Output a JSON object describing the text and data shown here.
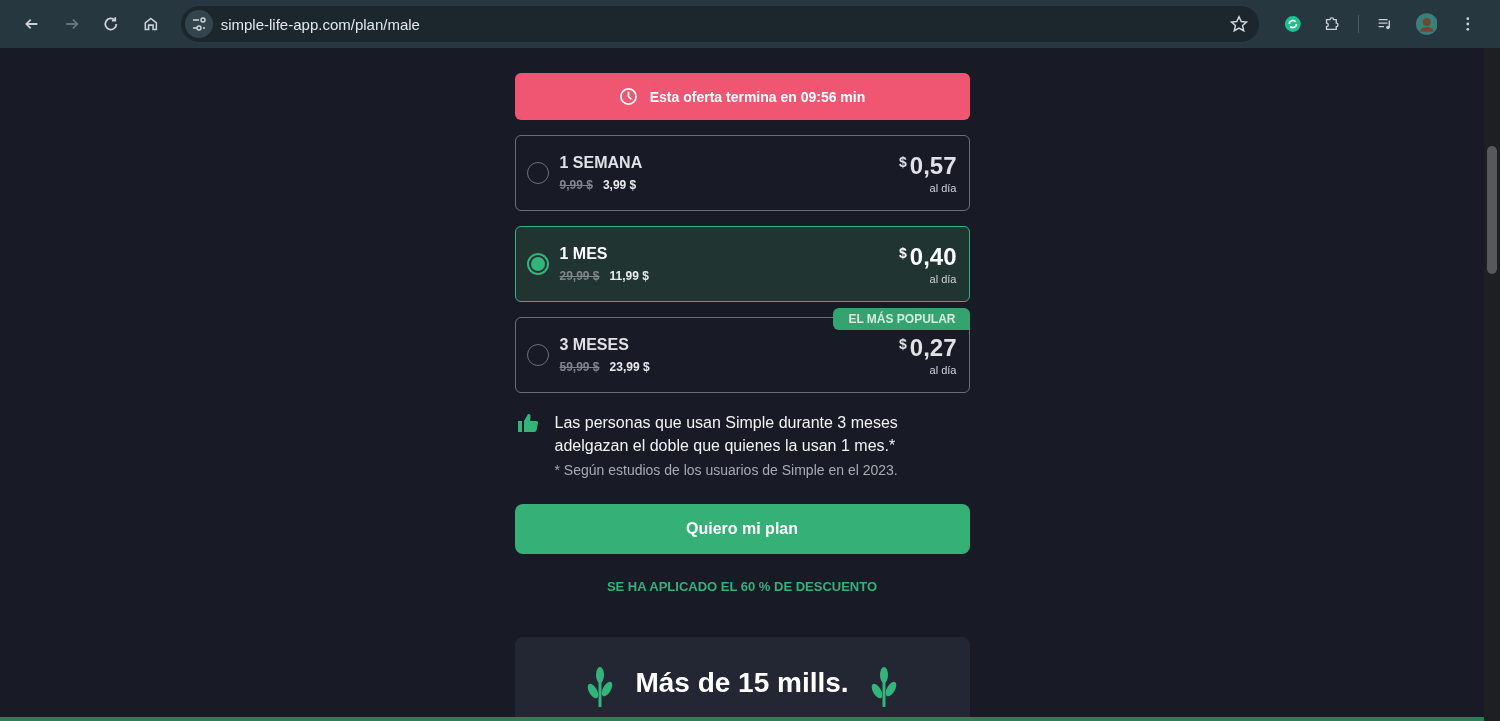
{
  "browser": {
    "url": "simple-life-app.com/plan/male"
  },
  "offer": {
    "text": "Esta oferta termina en 09:56 min"
  },
  "plans": [
    {
      "name": "1 SEMANA",
      "old_price": "9,99 $",
      "price": "3,99 $",
      "currency": "$",
      "daily": "0,57",
      "per": "al día",
      "selected": false
    },
    {
      "name": "1 MES",
      "old_price": "29,99 $",
      "price": "11,99 $",
      "currency": "$",
      "daily": "0,40",
      "per": "al día",
      "selected": true
    },
    {
      "name": "3 MESES",
      "old_price": "59,99 $",
      "price": "23,99 $",
      "currency": "$",
      "daily": "0,27",
      "per": "al día",
      "selected": false,
      "badge": "EL MÁS POPULAR"
    }
  ],
  "note": {
    "text": "Las personas que usan Simple durante 3 meses adelgazan el doble que quienes la usan 1 mes.*",
    "footnote": "* Según estudios de los usuarios de Simple en el 2023."
  },
  "cta": {
    "label": "Quiero mi plan"
  },
  "discount": "SE HA APLICADO EL 60 % DE DESCUENTO",
  "stats": {
    "title": "Más de 15 mills."
  }
}
